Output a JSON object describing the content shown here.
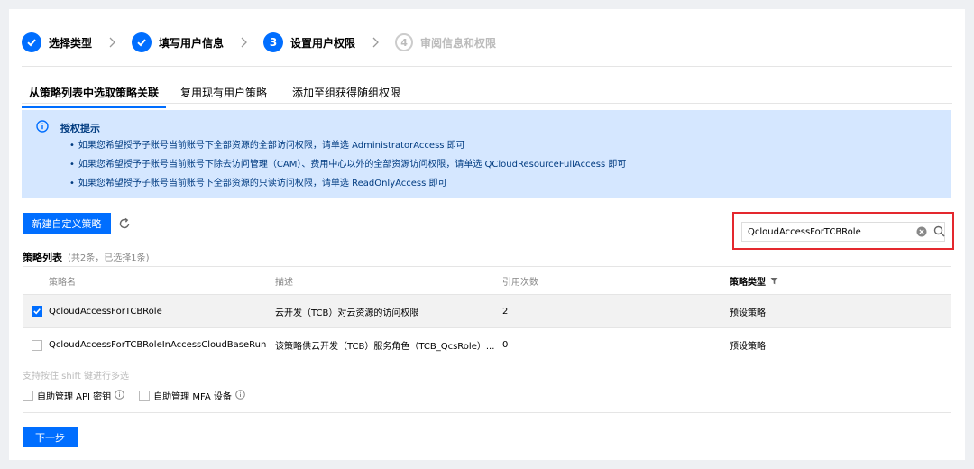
{
  "steps": [
    {
      "num": "",
      "label": "选择类型",
      "state": "done"
    },
    {
      "num": "",
      "label": "填写用户信息",
      "state": "done"
    },
    {
      "num": "3",
      "label": "设置用户权限",
      "state": "current"
    },
    {
      "num": "4",
      "label": "审阅信息和权限",
      "state": "pending"
    }
  ],
  "tabs": [
    {
      "label": "从策略列表中选取策略关联",
      "active": true
    },
    {
      "label": "复用现有用户策略",
      "active": false
    },
    {
      "label": "添加至组获得随组权限",
      "active": false
    }
  ],
  "alert": {
    "title": "授权提示",
    "items": [
      "如果您希望授予子账号当前账号下全部资源的全部访问权限，请单选 AdministratorAccess 即可",
      "如果您希望授予子账号当前账号下除去访问管理（CAM）、费用中心以外的全部资源访问权限，请单选 QCloudResourceFullAccess 即可",
      "如果您希望授予子账号当前账号下全部资源的只读访问权限，请单选 ReadOnlyAccess 即可"
    ]
  },
  "toolbar": {
    "new_policy_label": "新建自定义策略",
    "search_value": "QcloudAccessForTCBRole"
  },
  "policy_list": {
    "label": "策略列表",
    "count_text": "(共2条，已选择1条)",
    "columns": [
      "策略名",
      "描述",
      "引用次数",
      "策略类型"
    ],
    "rows": [
      {
        "name": "QcloudAccessForTCBRole",
        "description": "云开发（TCB）对云资源的访问权限",
        "refs": "2",
        "type": "预设策略",
        "checked": true
      },
      {
        "name": "QcloudAccessForTCBRoleInAccessCloudBaseRun",
        "description": "该策略供云开发（TCB）服务角色（TCB_QcsRole）...",
        "refs": "0",
        "type": "预设策略",
        "checked": false
      }
    ]
  },
  "hint": "支持按住 shift 键进行多选",
  "options": [
    {
      "label": "自助管理 API 密钥",
      "checked": false
    },
    {
      "label": "自助管理 MFA 设备",
      "checked": false
    }
  ],
  "next_label": "下一步",
  "colors": {
    "accent": "#006eff",
    "alert_bg": "#d5e7ff",
    "highlight_border": "#e4282e"
  },
  "icons": [
    "check-icon",
    "chevron-right-icon",
    "info-icon",
    "refresh-icon",
    "clear-icon",
    "search-icon",
    "filter-icon",
    "question-icon"
  ]
}
